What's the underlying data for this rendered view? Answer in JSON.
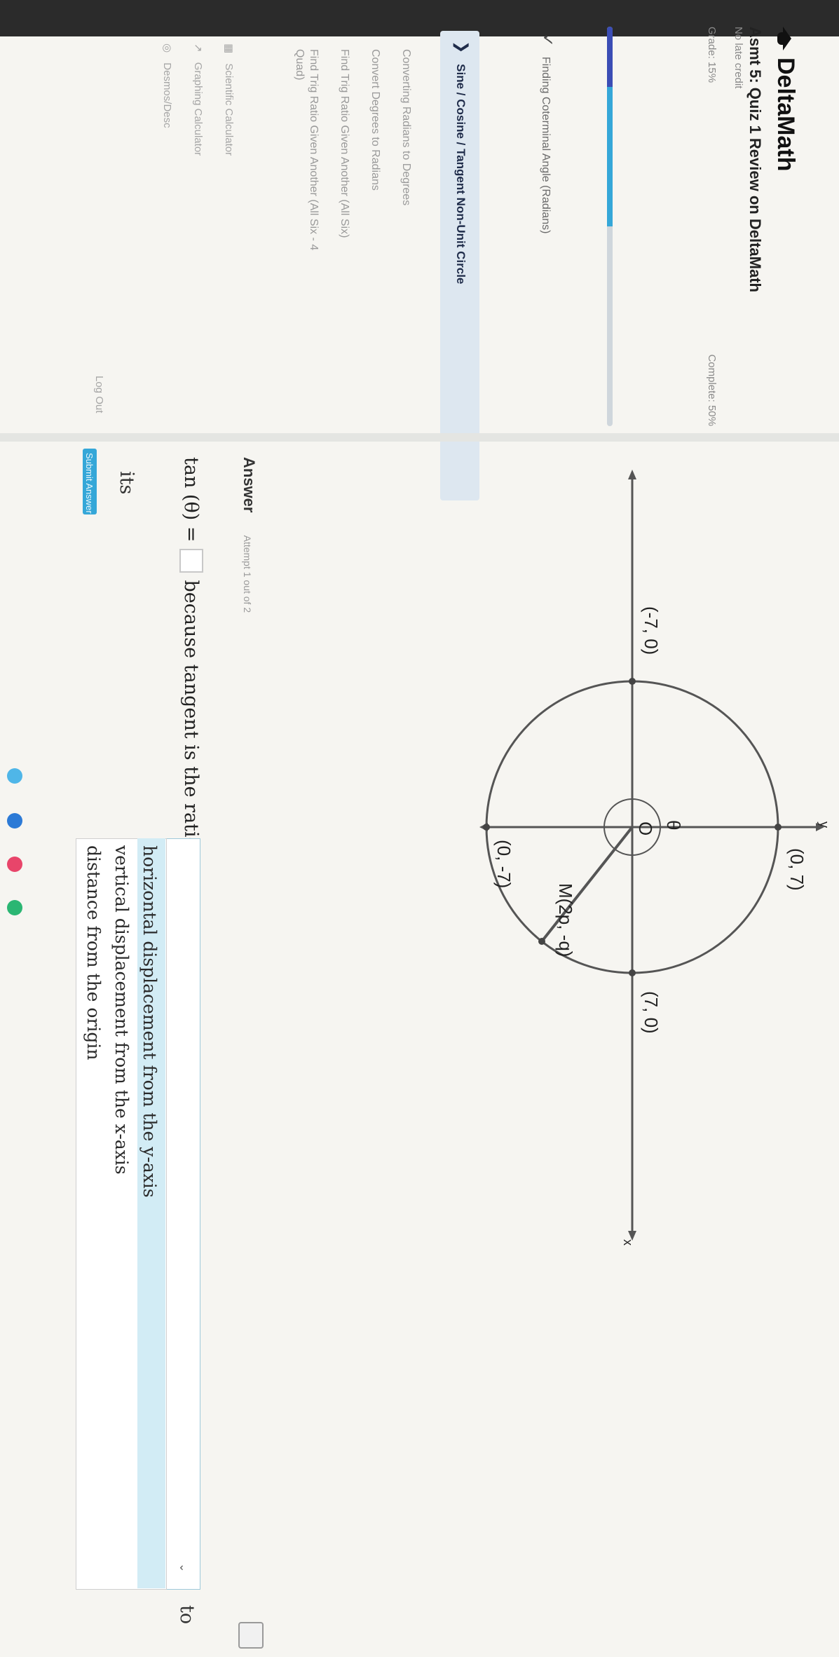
{
  "app": {
    "brand": "DeltaMath"
  },
  "assignment": {
    "title": "Asmt 5: Quiz 1 Review on DeltaMath",
    "meta": "No late credit",
    "grade_label": "Grade: 15%",
    "complete_label": "Complete: 50%",
    "grade_percent": 15,
    "complete_percent": 50
  },
  "nav": {
    "completed_item": "Finding Coterminal Angle (Radians)",
    "active_item": "Sine / Cosine / Tangent Non-Unit Circle",
    "items": [
      "Converting Radians to Degrees",
      "Convert Degrees to Radians",
      "Find Trig Ratio Given Another (All Six)",
      "Find Trig Ratio Given Another (All Six - 4",
      "Quad)"
    ]
  },
  "tools": {
    "scientific": "Scientific Calculator",
    "graphing": "Graphing Calculator",
    "desmos": "Desmos/Desc",
    "logout": "Log Out"
  },
  "figure": {
    "labels": {
      "top": "(0, 7)",
      "right": "(7, 0)",
      "left": "(-7, 0)",
      "bottom": "(0, -7)",
      "point": "M(2p, -q)",
      "theta": "θ",
      "origin": "O",
      "x_axis": "x",
      "y_axis": "y"
    }
  },
  "answer": {
    "label": "Answer",
    "attempt": "Attempt 1 out of 2",
    "equation_prefix": "tan (θ) =",
    "equation_suffix": "because tangent is the ratio of Point B's",
    "its_label": "its",
    "to_label": "to",
    "submit_label": "Submit Answer",
    "options": [
      "horizontal displacement from the y-axis",
      "vertical displacement from the x-axis",
      "distance from the origin"
    ]
  },
  "colors": {
    "accent": "#35a7d8",
    "progress": "#3b4db5",
    "highlight": "#d2ecf5"
  }
}
